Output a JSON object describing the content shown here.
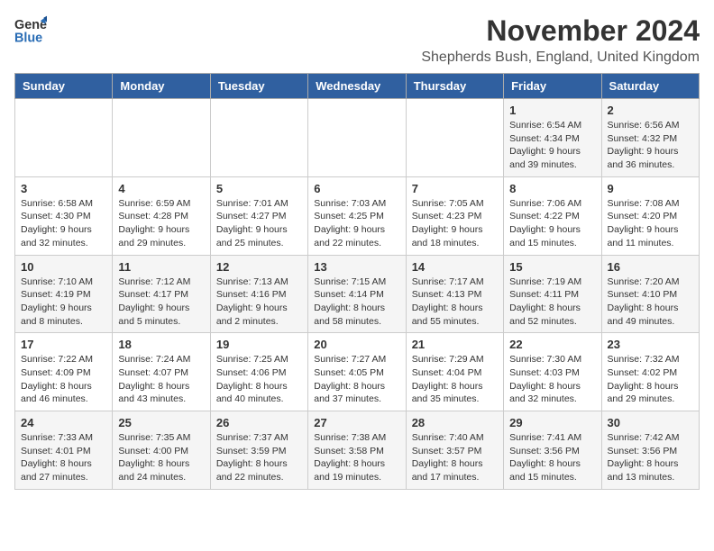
{
  "header": {
    "logo_general": "General",
    "logo_blue": "Blue",
    "month_title": "November 2024",
    "location": "Shepherds Bush, England, United Kingdom"
  },
  "weekdays": [
    "Sunday",
    "Monday",
    "Tuesday",
    "Wednesday",
    "Thursday",
    "Friday",
    "Saturday"
  ],
  "weeks": [
    [
      {
        "day": "",
        "info": ""
      },
      {
        "day": "",
        "info": ""
      },
      {
        "day": "",
        "info": ""
      },
      {
        "day": "",
        "info": ""
      },
      {
        "day": "",
        "info": ""
      },
      {
        "day": "1",
        "info": "Sunrise: 6:54 AM\nSunset: 4:34 PM\nDaylight: 9 hours and 39 minutes."
      },
      {
        "day": "2",
        "info": "Sunrise: 6:56 AM\nSunset: 4:32 PM\nDaylight: 9 hours and 36 minutes."
      }
    ],
    [
      {
        "day": "3",
        "info": "Sunrise: 6:58 AM\nSunset: 4:30 PM\nDaylight: 9 hours and 32 minutes."
      },
      {
        "day": "4",
        "info": "Sunrise: 6:59 AM\nSunset: 4:28 PM\nDaylight: 9 hours and 29 minutes."
      },
      {
        "day": "5",
        "info": "Sunrise: 7:01 AM\nSunset: 4:27 PM\nDaylight: 9 hours and 25 minutes."
      },
      {
        "day": "6",
        "info": "Sunrise: 7:03 AM\nSunset: 4:25 PM\nDaylight: 9 hours and 22 minutes."
      },
      {
        "day": "7",
        "info": "Sunrise: 7:05 AM\nSunset: 4:23 PM\nDaylight: 9 hours and 18 minutes."
      },
      {
        "day": "8",
        "info": "Sunrise: 7:06 AM\nSunset: 4:22 PM\nDaylight: 9 hours and 15 minutes."
      },
      {
        "day": "9",
        "info": "Sunrise: 7:08 AM\nSunset: 4:20 PM\nDaylight: 9 hours and 11 minutes."
      }
    ],
    [
      {
        "day": "10",
        "info": "Sunrise: 7:10 AM\nSunset: 4:19 PM\nDaylight: 9 hours and 8 minutes."
      },
      {
        "day": "11",
        "info": "Sunrise: 7:12 AM\nSunset: 4:17 PM\nDaylight: 9 hours and 5 minutes."
      },
      {
        "day": "12",
        "info": "Sunrise: 7:13 AM\nSunset: 4:16 PM\nDaylight: 9 hours and 2 minutes."
      },
      {
        "day": "13",
        "info": "Sunrise: 7:15 AM\nSunset: 4:14 PM\nDaylight: 8 hours and 58 minutes."
      },
      {
        "day": "14",
        "info": "Sunrise: 7:17 AM\nSunset: 4:13 PM\nDaylight: 8 hours and 55 minutes."
      },
      {
        "day": "15",
        "info": "Sunrise: 7:19 AM\nSunset: 4:11 PM\nDaylight: 8 hours and 52 minutes."
      },
      {
        "day": "16",
        "info": "Sunrise: 7:20 AM\nSunset: 4:10 PM\nDaylight: 8 hours and 49 minutes."
      }
    ],
    [
      {
        "day": "17",
        "info": "Sunrise: 7:22 AM\nSunset: 4:09 PM\nDaylight: 8 hours and 46 minutes."
      },
      {
        "day": "18",
        "info": "Sunrise: 7:24 AM\nSunset: 4:07 PM\nDaylight: 8 hours and 43 minutes."
      },
      {
        "day": "19",
        "info": "Sunrise: 7:25 AM\nSunset: 4:06 PM\nDaylight: 8 hours and 40 minutes."
      },
      {
        "day": "20",
        "info": "Sunrise: 7:27 AM\nSunset: 4:05 PM\nDaylight: 8 hours and 37 minutes."
      },
      {
        "day": "21",
        "info": "Sunrise: 7:29 AM\nSunset: 4:04 PM\nDaylight: 8 hours and 35 minutes."
      },
      {
        "day": "22",
        "info": "Sunrise: 7:30 AM\nSunset: 4:03 PM\nDaylight: 8 hours and 32 minutes."
      },
      {
        "day": "23",
        "info": "Sunrise: 7:32 AM\nSunset: 4:02 PM\nDaylight: 8 hours and 29 minutes."
      }
    ],
    [
      {
        "day": "24",
        "info": "Sunrise: 7:33 AM\nSunset: 4:01 PM\nDaylight: 8 hours and 27 minutes."
      },
      {
        "day": "25",
        "info": "Sunrise: 7:35 AM\nSunset: 4:00 PM\nDaylight: 8 hours and 24 minutes."
      },
      {
        "day": "26",
        "info": "Sunrise: 7:37 AM\nSunset: 3:59 PM\nDaylight: 8 hours and 22 minutes."
      },
      {
        "day": "27",
        "info": "Sunrise: 7:38 AM\nSunset: 3:58 PM\nDaylight: 8 hours and 19 minutes."
      },
      {
        "day": "28",
        "info": "Sunrise: 7:40 AM\nSunset: 3:57 PM\nDaylight: 8 hours and 17 minutes."
      },
      {
        "day": "29",
        "info": "Sunrise: 7:41 AM\nSunset: 3:56 PM\nDaylight: 8 hours and 15 minutes."
      },
      {
        "day": "30",
        "info": "Sunrise: 7:42 AM\nSunset: 3:56 PM\nDaylight: 8 hours and 13 minutes."
      }
    ]
  ]
}
